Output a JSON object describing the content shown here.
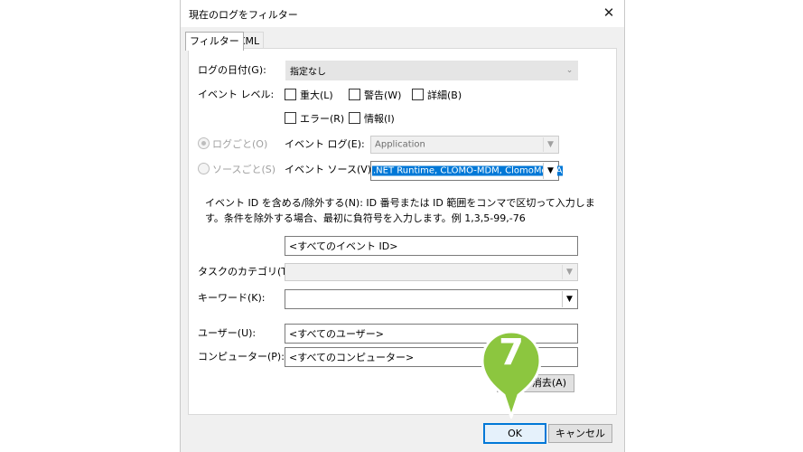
{
  "window": {
    "title": "現在のログをフィルター",
    "close_glyph": "✕"
  },
  "tabs": [
    {
      "label": "フィルター"
    },
    {
      "label": "XML"
    }
  ],
  "filter": {
    "logged_label": "ログの日付(G):",
    "logged_value": "指定なし",
    "event_level_label": "イベント レベル:",
    "levels": [
      {
        "label": "重大(L)"
      },
      {
        "label": "警告(W)"
      },
      {
        "label": "詳細(B)"
      },
      {
        "label": "エラー(R)"
      },
      {
        "label": "情報(I)"
      }
    ],
    "by_log_radio": "ログごと(O)",
    "by_source_radio": "ソースごと(S)",
    "event_log_label": "イベント ログ(E):",
    "event_log_value": "Application",
    "event_source_label": "イベント ソース(V):",
    "event_source_value": ".NET Runtime, CLOMO-MDM, ClomoMdmA",
    "event_id_description": "イベント ID を含める/除外する(N): ID 番号または ID 範囲をコンマで区切って入力します。条件を除外する場合、最初に負符号を入力します。例 1,3,5-99,-76",
    "event_id_value": "<すべてのイベント ID>",
    "task_category_label": "タスクのカテゴリ(T):",
    "task_category_value": "",
    "keywords_label": "キーワード(K):",
    "keywords_value": "",
    "user_label": "ユーザー(U):",
    "user_value": "<すべてのユーザー>",
    "computer_label": "コンピューター(P):",
    "computer_value": "<すべてのコンピューター>",
    "clear_button": "消去(A)"
  },
  "buttons": {
    "ok": "OK",
    "cancel": "キャンセル"
  },
  "step_marker": {
    "number": "7",
    "color": "#8cc63f"
  }
}
